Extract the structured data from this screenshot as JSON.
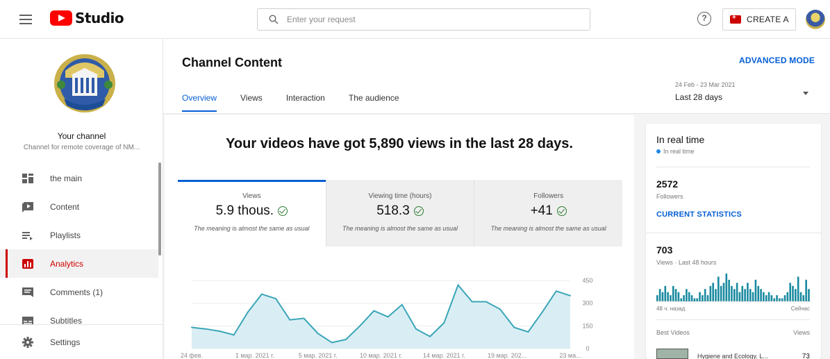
{
  "header": {
    "app_name": "Studio",
    "search_placeholder": "Enter your request",
    "help_glyph": "?",
    "create_label": "CREATE A"
  },
  "sidebar": {
    "channel_title": "Your channel",
    "channel_desc": "Channel for remote coverage of NM...",
    "items": [
      {
        "label": "the main",
        "icon": "dashboard-icon"
      },
      {
        "label": "Content",
        "icon": "video-icon"
      },
      {
        "label": "Playlists",
        "icon": "playlist-icon"
      },
      {
        "label": "Analytics",
        "icon": "analytics-icon",
        "active": true
      },
      {
        "label": "Comments (1)",
        "icon": "comments-icon"
      },
      {
        "label": "Subtitles",
        "icon": "subtitles-icon"
      }
    ],
    "settings_label": "Settings"
  },
  "main": {
    "title": "Channel Content",
    "advanced_mode": "ADVANCED MODE",
    "tabs": [
      "Overview",
      "Views",
      "Interaction",
      "The audience"
    ],
    "date_range": "24 Feb - 23 Mar 2021",
    "date_period": "Last 28 days",
    "headline": "Your videos have got 5,890 views in the last 28 days.",
    "metrics": [
      {
        "label": "Views",
        "value": "5.9 thous.",
        "note": "The meaning is almost the same as usual"
      },
      {
        "label": "Viewing time (hours)",
        "value": "518.3",
        "note": "The meaning is almost the same as usual"
      },
      {
        "label": "Followers",
        "value": "+41",
        "note": "The meaning is almost the same as usual"
      }
    ]
  },
  "chart_data": {
    "type": "area",
    "y_ticks": [
      "450",
      "300",
      "150",
      "0"
    ],
    "ylim": [
      0,
      450
    ],
    "x_labels": [
      "24 фев.",
      "1 мар. 2021 г.",
      "5 мар. 2021 г.",
      "10 мар. 2021 г.",
      "14 мар. 2021 г.",
      "19 мар. 202...",
      "23 ма..."
    ],
    "series": [
      {
        "values": [
          140,
          130,
          115,
          90,
          240,
          360,
          330,
          190,
          200,
          100,
          40,
          60,
          150,
          250,
          210,
          290,
          130,
          80,
          170,
          420,
          310,
          310,
          260,
          140,
          110,
          240,
          380,
          350
        ]
      }
    ],
    "color": "#3aa5b8",
    "fill": "#d9eef4"
  },
  "realtime": {
    "title": "In real time",
    "subtitle": "In real time",
    "subscribers_value": "2572",
    "subscribers_label": "Followers",
    "current_stats": "CURRENT STATISTICS",
    "views_value": "703",
    "views_label": "Views · Last 48 hours",
    "ago_label": "48 ч. назад",
    "now_label": "Сейчас",
    "best_videos_label": "Best Videos",
    "views_col_label": "Views",
    "top_video_title": "Hygiene and Ecology. L...",
    "top_video_views": "73",
    "bar_values": [
      2,
      4,
      3,
      5,
      3,
      2,
      5,
      4,
      3,
      1,
      2,
      4,
      3,
      2,
      1,
      1,
      3,
      2,
      4,
      2,
      5,
      6,
      4,
      8,
      5,
      6,
      9,
      7,
      5,
      4,
      6,
      3,
      5,
      4,
      6,
      4,
      3,
      7,
      5,
      4,
      3,
      2,
      3,
      2,
      1,
      2,
      1,
      1,
      2,
      3,
      6,
      5,
      4,
      8,
      3,
      2,
      7,
      4
    ],
    "bar_color": "#1a8aa0"
  }
}
